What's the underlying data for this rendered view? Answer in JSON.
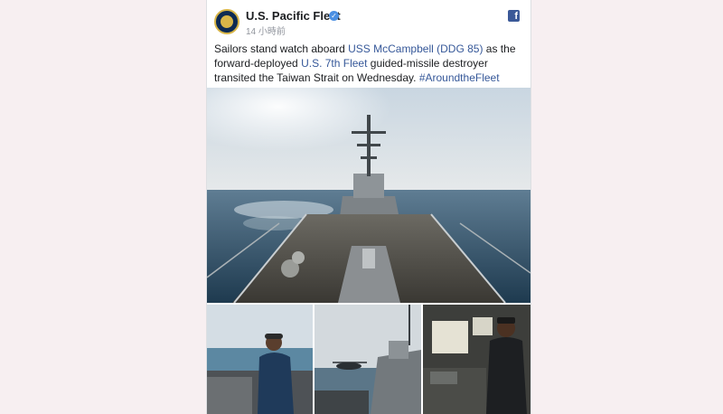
{
  "post": {
    "page_name": "U.S. Pacific Fleet",
    "timestamp": "14 小時前",
    "text_parts": [
      "Sailors stand watch aboard ",
      "USS McCampbell (DDG 85)",
      " as the forward-deployed ",
      "U.S. 7th Fleet",
      " guided-missile destroyer transited the Taiwan Strait on Wednesday. ",
      "#AroundtheFleet"
    ]
  },
  "icons": {
    "verified": "verified-badge-icon",
    "facebook": "facebook-icon"
  },
  "colors": {
    "link": "#365899",
    "page_bg": "#f7eff1",
    "facebook": "#3b5998"
  }
}
